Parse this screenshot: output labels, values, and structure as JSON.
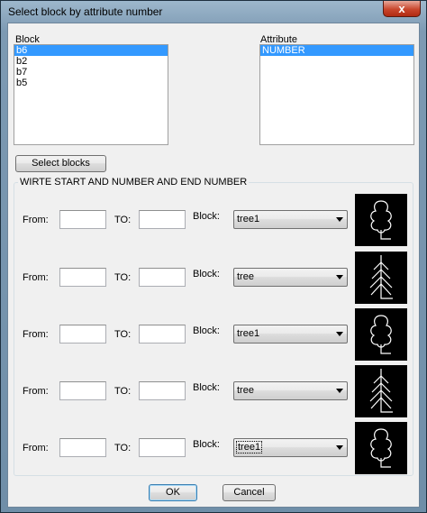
{
  "window": {
    "title": "Select block by attribute number",
    "close_glyph": "x"
  },
  "block_list": {
    "label": "Block",
    "items": [
      "b6",
      "b2",
      "b7",
      "b5"
    ],
    "selected_index": 0
  },
  "attribute_list": {
    "label": "Attribute",
    "items": [
      "NUMBER"
    ],
    "selected_index": 0
  },
  "select_blocks_button": "Select blocks",
  "group": {
    "label": "WIRTE START AND NUMBER AND END NUMBER"
  },
  "row_labels": {
    "from": "From:",
    "to": "TO:",
    "block": "Block:"
  },
  "rows": [
    {
      "from": "",
      "to": "",
      "block": "tree1",
      "preview": "tree1-icon"
    },
    {
      "from": "",
      "to": "",
      "block": "tree",
      "preview": "tree-icon"
    },
    {
      "from": "",
      "to": "",
      "block": "tree1",
      "preview": "tree1-icon"
    },
    {
      "from": "",
      "to": "",
      "block": "tree",
      "preview": "tree-icon"
    },
    {
      "from": "",
      "to": "",
      "block": "tree1",
      "preview": "tree1-icon"
    }
  ],
  "buttons": {
    "ok": "OK",
    "cancel": "Cancel"
  }
}
